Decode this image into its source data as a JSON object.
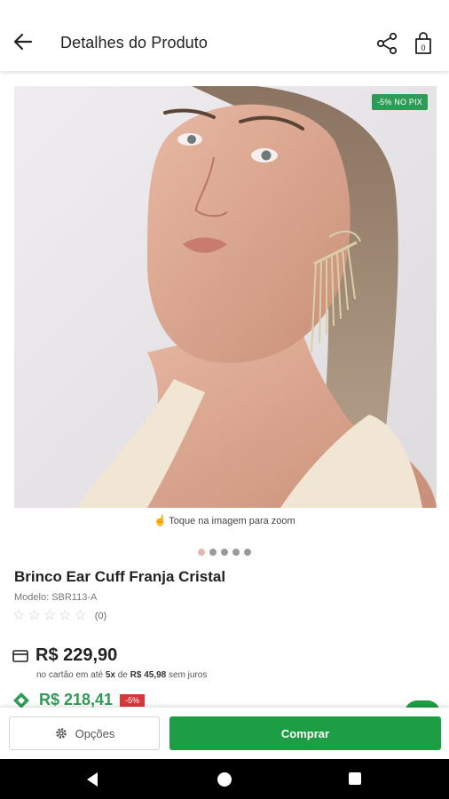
{
  "header": {
    "title": "Detalhes do Produto",
    "cart_count": "0"
  },
  "image": {
    "badge": "-5% NO PIX",
    "zoom_hint": "Toque na imagem para zoom"
  },
  "carousel": {
    "total": 5,
    "active": 1
  },
  "product": {
    "name": "Brinco Ear Cuff Franja Cristal",
    "model": "Modelo: SBR113-A",
    "rating_count": "(0)",
    "stars": 0
  },
  "price": {
    "card_price": "R$ 229,90",
    "installments_prefix": "no cartão em até",
    "installments_count": "5x",
    "installments_mid": "de",
    "installments_value": "R$ 45,98",
    "installments_suffix": "sem juros",
    "pix_price": "R$ 218,41",
    "pix_discount": "-5%"
  },
  "actions": {
    "options_label": "Opções",
    "buy_label": "Comprar"
  },
  "colors": {
    "green": "#1d9e45",
    "pix_green": "#2e9b57",
    "discount_red": "#d8373c"
  }
}
